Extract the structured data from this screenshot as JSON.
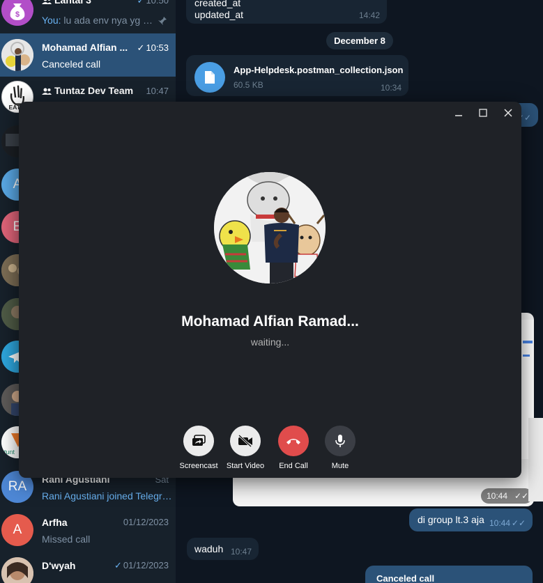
{
  "sidebar": {
    "chats": [
      {
        "name": "Lantai 3",
        "time": "10:50",
        "preview_sender": "You:",
        "preview": "lu ada env nya yg k..."
      },
      {
        "name": "Mohamad Alfian ...",
        "time": "10:53",
        "preview": "Canceled call"
      },
      {
        "name": "Tuntaz Dev Team",
        "time": "10:47"
      },
      {
        "name": "Rani Agustiani",
        "time": "Sat",
        "preview": "Rani Agustiani joined Telegram",
        "initials": "RA"
      },
      {
        "name": "Arfha",
        "time": "01/12/2023",
        "preview": "Missed call",
        "initials": "A"
      },
      {
        "name": "D'wyah",
        "time": "01/12/2023"
      }
    ],
    "partial_initials": [
      "A",
      "E"
    ],
    "colors": {
      "accent": "#2b5278",
      "link": "#6ab3f3"
    }
  },
  "chat": {
    "msg_created_lines": [
      "created_at",
      "updated_at"
    ],
    "msg_created_time": "14:42",
    "date_separator": "December 8",
    "file": {
      "name": "App-Helpdesk.postman_collection.json",
      "size": "60.5 KB",
      "time": "10:34"
    },
    "screenshot_time": "10:44",
    "msg_group": {
      "text": "di group lt.3 aja",
      "time": "10:44"
    },
    "msg_waduh": {
      "text": "waduh",
      "time": "10:47"
    },
    "msg_canceled": "Canceled call"
  },
  "call": {
    "name": "Mohamad Alfian Ramad...",
    "status": "waiting...",
    "buttons": {
      "screencast": "Screencast",
      "video": "Start Video",
      "end": "End Call",
      "mute": "Mute"
    },
    "colors": {
      "end": "#e04c4c",
      "light": "#ebebeb",
      "dark": "#3b3e45"
    }
  }
}
